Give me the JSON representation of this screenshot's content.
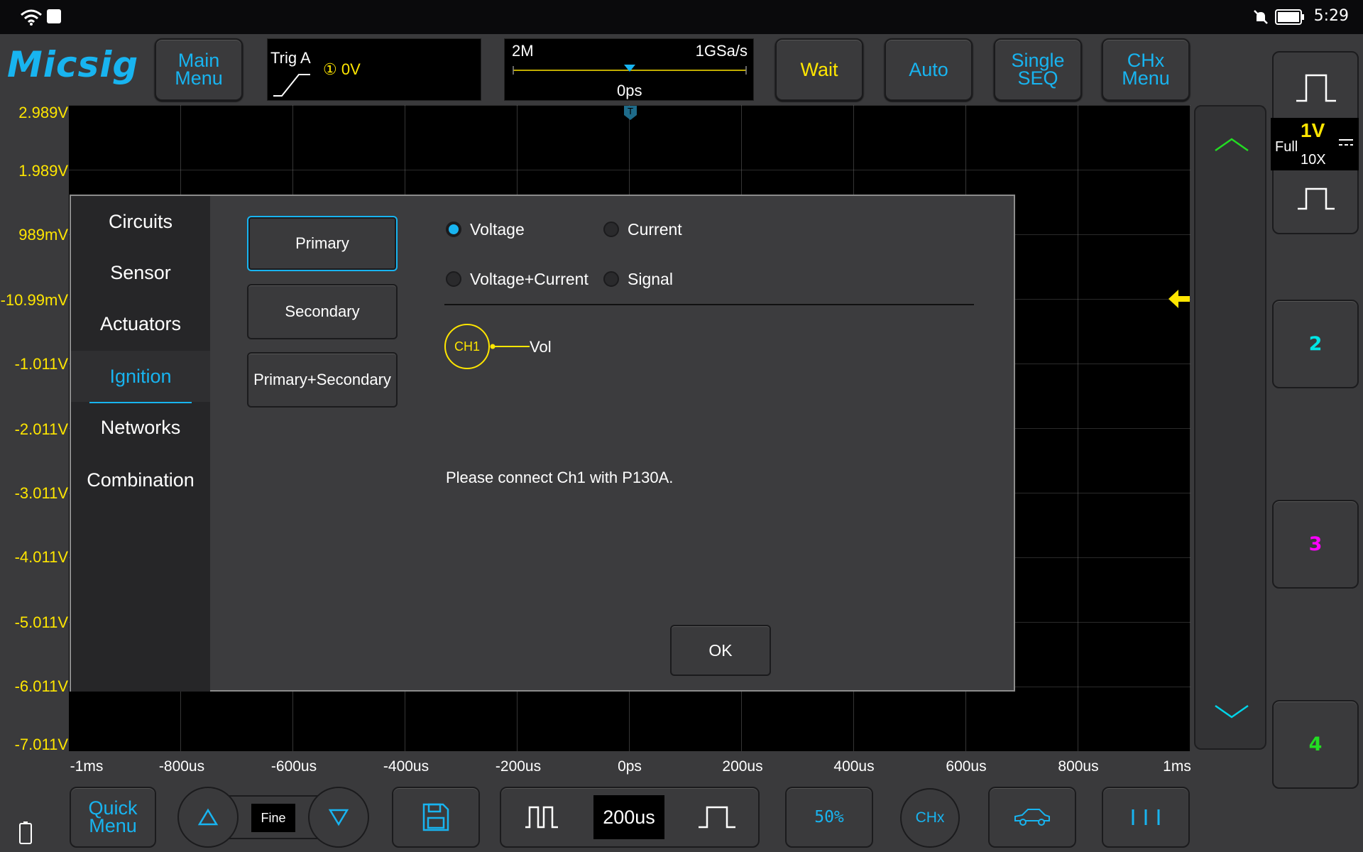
{
  "status": {
    "time": "5:29"
  },
  "brand": "Micsig",
  "toolbar": {
    "main_menu": "Main\nMenu",
    "trig_label": "Trig A",
    "trig_level": "① 0V",
    "memory": "2M",
    "sample_rate": "1GSa/s",
    "trig_pos": "0ps",
    "wait": "Wait",
    "auto": "Auto",
    "single": "Single\nSEQ",
    "chx_menu": "CHx\nMenu"
  },
  "volt_labels": [
    "2.989V",
    "1.989V",
    "989mV",
    "-10.99mV",
    "-1.011V",
    "-2.011V",
    "-3.011V",
    "-4.011V",
    "-5.011V",
    "-6.011V",
    "-7.011V"
  ],
  "time_labels": [
    "-1ms",
    "-800us",
    "-600us",
    "-400us",
    "-200us",
    "0ps",
    "200us",
    "400us",
    "600us",
    "800us",
    "1ms"
  ],
  "channel": {
    "scale": "1V",
    "bw": "Full",
    "probe": "10X",
    "ch2": "2",
    "ch3": "3",
    "ch4": "4"
  },
  "bottom": {
    "quick_menu": "Quick\nMenu",
    "fine": "Fine",
    "timebase": "200us",
    "fifty": "50%",
    "chx": "CHx"
  },
  "dialog": {
    "categories": [
      "Circuits",
      "Sensor",
      "Actuators",
      "Ignition",
      "Networks",
      "Combination"
    ],
    "options": [
      "Primary",
      "Secondary",
      "Primary+Secondary"
    ],
    "radios": [
      "Voltage",
      "Current",
      "Voltage+Current",
      "Signal"
    ],
    "ch_label": "CH1",
    "ch_signal": "Vol",
    "message": "Please connect Ch1 with P130A.",
    "ok": "OK"
  },
  "colors": {
    "accent": "#18b4f0",
    "ch1": "#ffe600",
    "ch2": "#00e5e5",
    "ch3": "#ff00ff",
    "ch4": "#22dd22"
  }
}
